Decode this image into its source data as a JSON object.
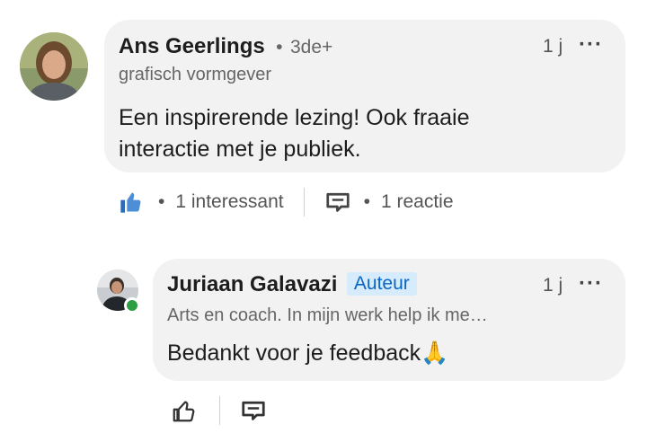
{
  "comment1": {
    "author": "Ans Geerlings",
    "degree": "3de+",
    "headline": "grafisch vormgever",
    "time": "1 j",
    "more": "···",
    "text_line1": "Een inspirerende lezing! Ook fraaie",
    "text_line2": "interactie met je publiek.",
    "reactions": "1 interessant",
    "replies": "1 reactie",
    "bullet": "•",
    "reaction_icon": "thumbs-up-filled-icon",
    "reply_icon": "comment-icon"
  },
  "reply1": {
    "author": "Juriaan Galavazi",
    "badge": "Auteur",
    "headline": "Arts en coach. In mijn werk help ik me…",
    "time": "1 j",
    "more": "···",
    "text": "Bedankt voor je feedback",
    "emoji": "🙏",
    "react_icon": "thumbs-up-outline-icon",
    "reply_icon": "comment-icon",
    "online_color": "#2e9e43"
  },
  "colors": {
    "bubble": "#f2f2f2",
    "accent": "#0a66c2",
    "badge_bg": "#d6ebfb"
  }
}
